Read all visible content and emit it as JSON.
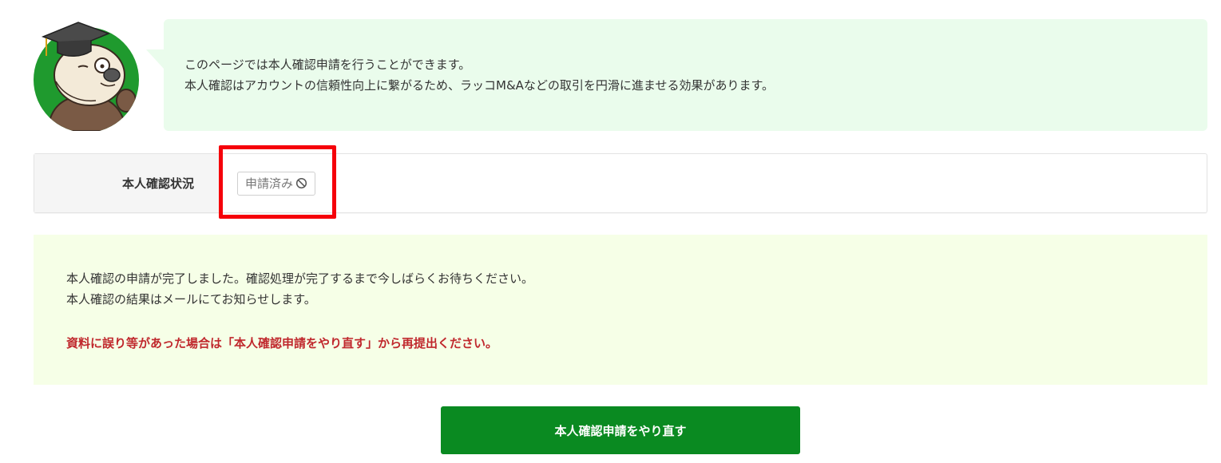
{
  "intro": {
    "avatar_icon": "otter-scholar-mascot",
    "line1": "このページでは本人確認申請を行うことができます。",
    "line2": "本人確認はアカウントの信頼性向上に繋がるため、ラッコM&Aなどの取引を円滑に進ませる効果があります。"
  },
  "status": {
    "label": "本人確認状況",
    "badge_text": "申請済み",
    "badge_icon": "prohibited-icon"
  },
  "notice": {
    "line1": "本人確認の申請が完了しました。確認処理が完了するまで今しばらくお待ちください。",
    "line2": "本人確認の結果はメールにてお知らせします。",
    "warning": "資料に誤り等があった場合は「本人確認申請をやり直す」から再提出ください。"
  },
  "actions": {
    "redo_label": "本人確認申請をやり直す"
  },
  "colors": {
    "intro_bg": "#eafcec",
    "notice_bg": "#f6ffe7",
    "warning_text": "#c0282d",
    "button_bg": "#0a8a21",
    "highlight_border": "#f5000a"
  }
}
